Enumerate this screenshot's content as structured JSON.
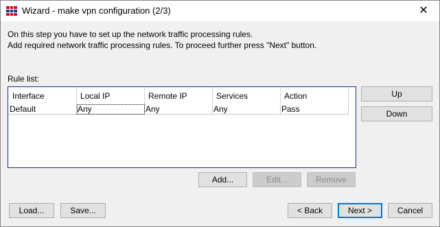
{
  "window": {
    "title": "Wizard - make vpn configuration (2/3)",
    "close_glyph": "✕"
  },
  "intro": {
    "line1": "On this step you have to set up the network traffic processing rules.",
    "line2": "Add required network traffic processing rules. To proceed further press \"Next\" button."
  },
  "rule_list": {
    "label": "Rule list:",
    "columns": [
      "Interface",
      "Local IP",
      "Remote IP",
      "Services",
      "Action"
    ],
    "rows": [
      [
        "Default",
        "Any",
        "Any",
        "Any",
        "Pass"
      ]
    ]
  },
  "side_buttons": {
    "up": "Up",
    "down": "Down"
  },
  "list_buttons": {
    "add": "Add...",
    "edit": "Edit...",
    "remove": "Remove"
  },
  "footer_buttons": {
    "load": "Load...",
    "save": "Save...",
    "back": "< Back",
    "next": "Next >",
    "cancel": "Cancel"
  },
  "colors": {
    "list_border": "#1b2a8a",
    "default_button": "#0078d7",
    "icon_red": "#c8102e",
    "icon_blue": "#1f3a93"
  }
}
